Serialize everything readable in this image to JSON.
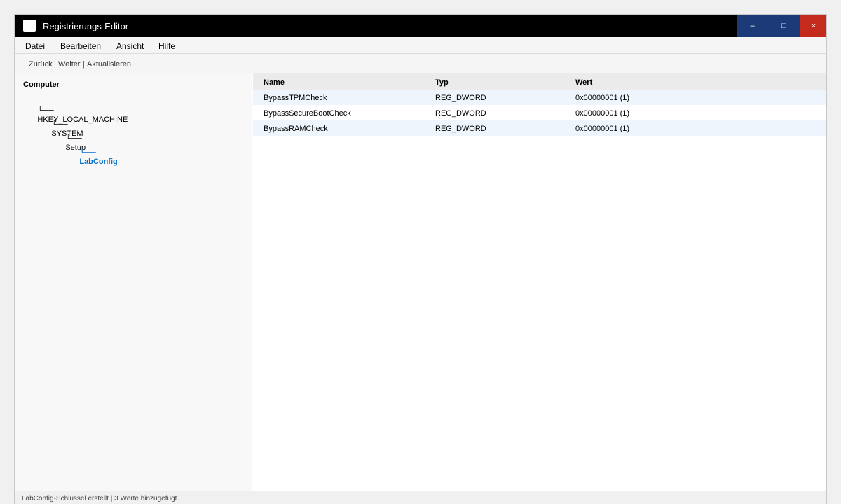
{
  "window": {
    "title": "Registrierungs-Editor",
    "minimize_glyph": "–",
    "maximize_glyph": "□",
    "close_glyph": "×"
  },
  "menu": [
    "Datei",
    "Bearbeiten",
    "Ansicht",
    "Hilfe"
  ],
  "navigation": {
    "back": "Zurück",
    "forward": "Weiter",
    "refresh": "Aktualisieren",
    "separator": "|"
  },
  "tree": {
    "header": "Computer",
    "branch_glyph": "└──",
    "nodes": [
      {
        "label": "HKEY_LOCAL_MACHINE",
        "depth": 0,
        "selected": false
      },
      {
        "label": "SYSTEM",
        "depth": 1,
        "selected": false
      },
      {
        "label": "Setup",
        "depth": 2,
        "selected": false
      },
      {
        "label": "LabConfig",
        "depth": 3,
        "selected": true
      }
    ]
  },
  "list": {
    "columns": [
      "Name",
      "Typ",
      "Wert"
    ],
    "rows": [
      {
        "name": "BypassTPMCheck",
        "type": "REG_DWORD",
        "value": "0x00000001 (1)"
      },
      {
        "name": "BypassSecureBootCheck",
        "type": "REG_DWORD",
        "value": "0x00000001 (1)"
      },
      {
        "name": "BypassRAMCheck",
        "type": "REG_DWORD",
        "value": "0x00000001 (1)"
      }
    ]
  },
  "status": {
    "text": "LabConfig-Schlüssel erstellt | 3 Werte hinzugefügt"
  },
  "colors": {
    "titlebar": "#000000",
    "window_button": "#1c3a78",
    "close_button": "#c42b1c",
    "selected_node": "#0b6fc7",
    "row_highlight": "#eef5fd"
  }
}
